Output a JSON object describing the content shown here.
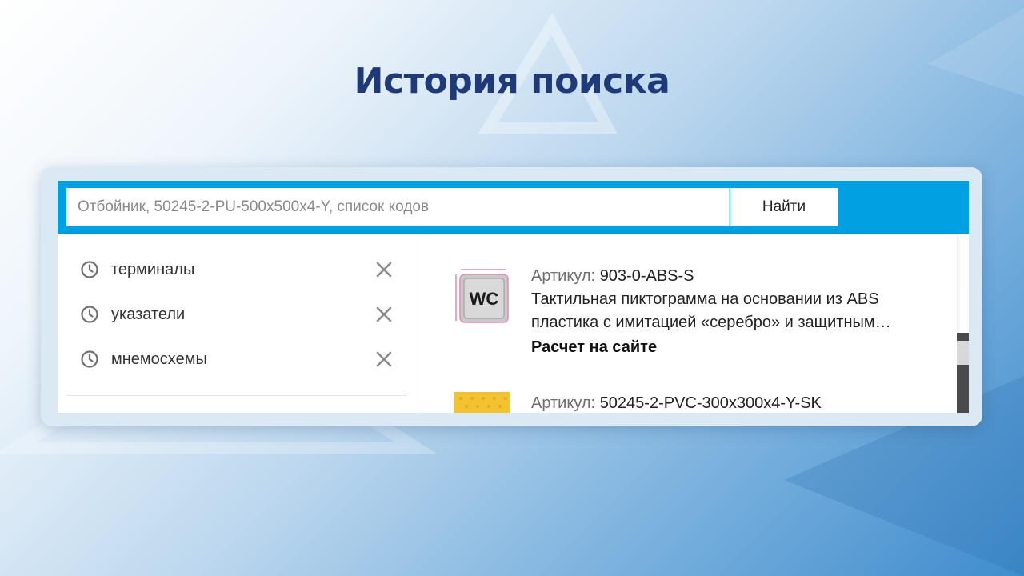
{
  "slide": {
    "title": "История поиска"
  },
  "search": {
    "placeholder": "Отбойник, 50245-2-PU-500x500x4-Y, список кодов",
    "button_label": "Найти"
  },
  "history": {
    "items": [
      {
        "label": "терминалы",
        "icon": "clock-icon",
        "action_icon": "close-icon"
      },
      {
        "label": "указатели",
        "icon": "clock-icon",
        "action_icon": "close-icon"
      },
      {
        "label": "мнемосхемы",
        "icon": "clock-icon",
        "action_icon": "close-icon"
      }
    ]
  },
  "products": [
    {
      "sku_label": "Артикул:",
      "sku": "903-0-ABS-S",
      "description_line1": "Тактильная пиктограмма на основании из ABS",
      "description_line2": "пластика с имитацией «серебро» и защитным…",
      "cta": "Расчет на сайте",
      "thumb_text": "WC",
      "thumb_icon": "wc-sign-thumbnail"
    },
    {
      "sku_label": "Артикул:",
      "sku": "50245-2-PVC-300x300x4-Y-SK",
      "thumb_icon": "yellow-tactile-tile-thumbnail"
    }
  ],
  "colors": {
    "title": "#1e3a78",
    "search_bar": "#00a0e3",
    "tile_yellow": "#f2c230"
  }
}
